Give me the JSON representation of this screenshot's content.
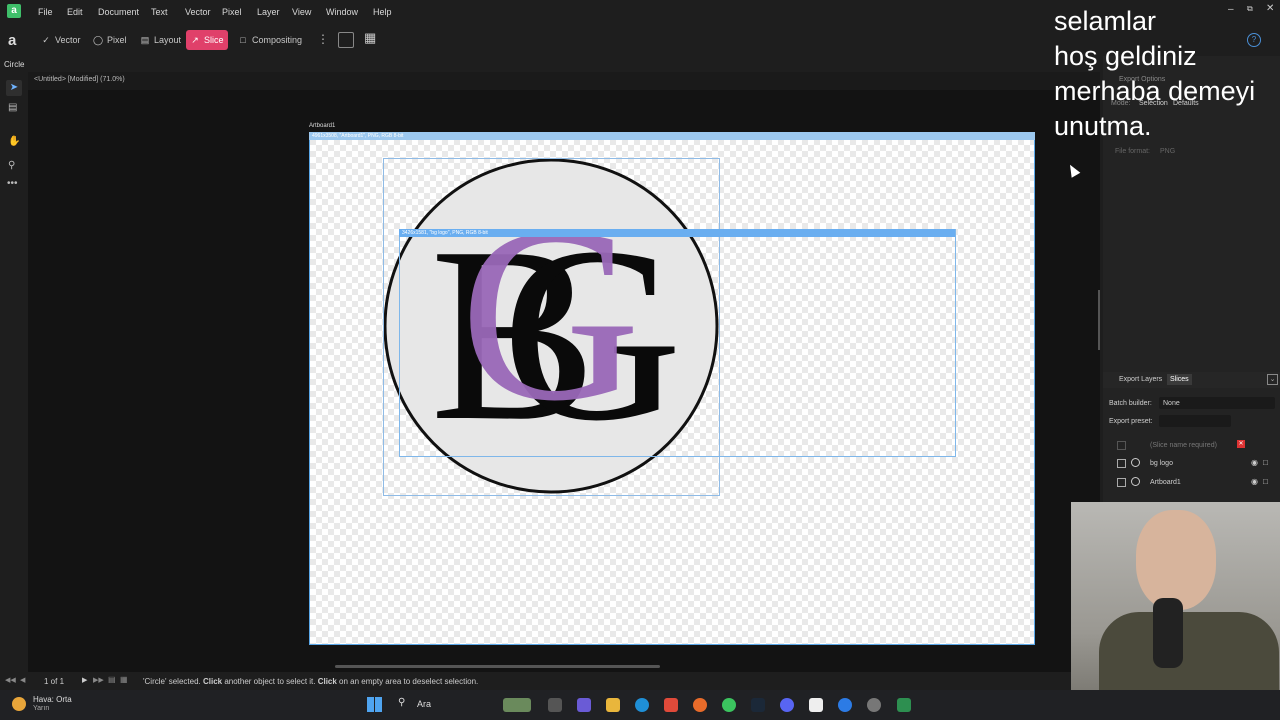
{
  "app": {
    "name": "Affinity Designer"
  },
  "menubar": {
    "items": [
      "File",
      "Edit",
      "Document",
      "Text",
      "Vector",
      "Pixel",
      "Layer",
      "View",
      "Window",
      "Help"
    ]
  },
  "toolbar": {
    "personas": [
      "Vector",
      "Pixel",
      "Layout",
      "Slice",
      "Compositing"
    ],
    "active_persona": "Slice"
  },
  "context": {
    "selection_label": "Circle"
  },
  "document": {
    "tab_title": "<Untitled> [Modified] (71.0%)"
  },
  "canvas": {
    "artboard_label": "Artboard1",
    "artboard_bar_text": "4961x3508, \"Artboard1\", PNG, RGB 8-bit",
    "slice_bar_text": "3426x1581, \"bg logo\", PNG, RGB 8-bit",
    "logo_letters": "BG"
  },
  "overlay": {
    "lines": [
      "selamlar",
      "hoş geldiniz",
      "merhaba demeyi",
      "unutma."
    ]
  },
  "export_options": {
    "title": "Export Options",
    "mode_label": "Mode:",
    "mode_selection": "Selection",
    "mode_defaults": "Defaults",
    "file_format_label": "File format:",
    "file_format_value": "PNG"
  },
  "export_panel": {
    "tabs": [
      "Export Layers",
      "Slices"
    ],
    "active_tab": "Slices",
    "batch_builder_label": "Batch builder:",
    "batch_builder_value": "None",
    "export_preset_label": "Export preset:",
    "slices": [
      {
        "name": "(Slice name required)",
        "enabled": false
      },
      {
        "name": "bg logo",
        "enabled": true
      },
      {
        "name": "Artboard1",
        "enabled": true
      }
    ]
  },
  "status": {
    "page": "1 of 1",
    "hint_prefix": "'Circle' selected. ",
    "hint_click1": "Click",
    "hint_mid": " another object to select it. ",
    "hint_click2": "Click",
    "hint_suffix": " on an empty area to deselect selection."
  },
  "taskbar": {
    "weather_line1": "Hava: Orta",
    "weather_line2": "Yarın",
    "search_placeholder": "Ara"
  },
  "colors": {
    "accent": "#e0406a",
    "logo_purple": "#9a68b8",
    "selection_blue": "#5aa7e8"
  }
}
